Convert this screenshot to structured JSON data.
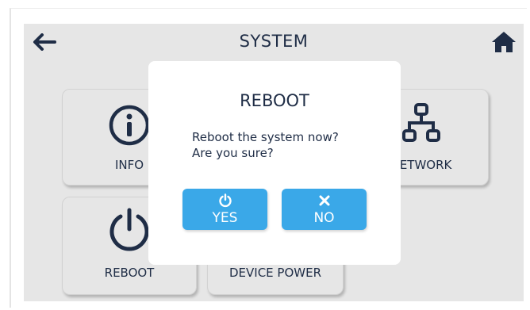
{
  "header": {
    "title": "SYSTEM",
    "back_icon": "arrow-left-icon",
    "home_icon": "home-icon"
  },
  "tiles": [
    {
      "label": "INFO",
      "icon": "info-icon"
    },
    {
      "label": "NETWORK",
      "icon": "network-icon"
    },
    {
      "label": "REBOOT",
      "icon": "power-icon"
    },
    {
      "label": "DEVICE POWER",
      "icon": "device-power-icon"
    }
  ],
  "dialog": {
    "title": "REBOOT",
    "message_line1": "Reboot the system now?",
    "message_line2": "Are you sure?",
    "yes_label": "YES",
    "no_label": "NO",
    "yes_icon": "power-icon",
    "no_icon": "close-icon"
  },
  "colors": {
    "accent": "#3aa8e8",
    "text": "#1f2d46",
    "background": "#e6e6e6"
  }
}
